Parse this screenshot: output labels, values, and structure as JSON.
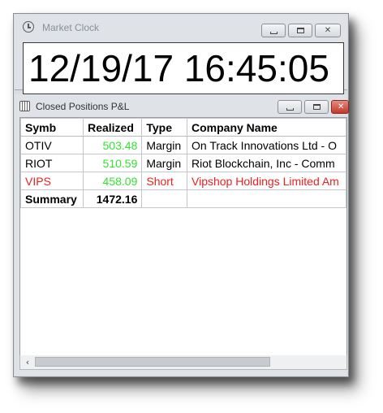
{
  "market_clock": {
    "title": "Market Clock",
    "datetime": "12/19/17 16:45:05"
  },
  "closed_positions": {
    "title": "Closed Positions P&L",
    "columns": [
      "Symb",
      "Realized",
      "Type",
      "Company Name"
    ],
    "rows": [
      {
        "symb": "OTIV",
        "realized": "503.48",
        "type": "Margin",
        "company": "On Track Innovations Ltd - O"
      },
      {
        "symb": "RIOT",
        "realized": "510.59",
        "type": "Margin",
        "company": "Riot Blockchain, Inc - Comm"
      },
      {
        "symb": "VIPS",
        "realized": "458.09",
        "type": "Short",
        "company": "Vipshop Holdings Limited Am"
      }
    ],
    "summary": {
      "label": "Summary",
      "realized": "1472.16"
    }
  },
  "colors": {
    "profit": "#33e333",
    "short": "#ee2020",
    "close_button": "#c4382a"
  },
  "icons": {
    "clock": "clock-icon",
    "table": "table-icon",
    "minimize": "minimize-icon",
    "maximize": "maximize-icon",
    "close": "close-icon",
    "scroll_left": "chevron-left-icon"
  }
}
